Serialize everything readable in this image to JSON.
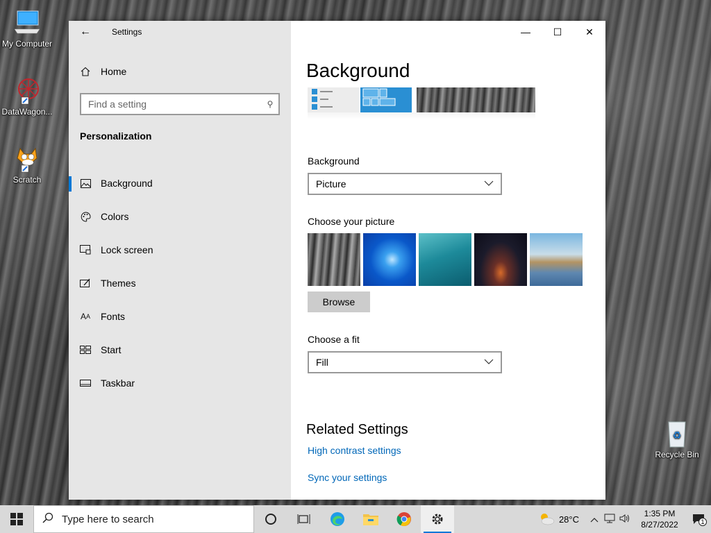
{
  "desktop": {
    "icons": [
      {
        "label": "My Computer"
      },
      {
        "label": "DataWagon..."
      },
      {
        "label": "Scratch"
      },
      {
        "label": "Recycle Bin"
      }
    ]
  },
  "window": {
    "title": "Settings",
    "nav": {
      "home": "Home",
      "search_placeholder": "Find a setting",
      "section": "Personalization",
      "items": [
        {
          "label": "Background",
          "icon": "picture-icon",
          "active": true
        },
        {
          "label": "Colors",
          "icon": "palette-icon"
        },
        {
          "label": "Lock screen",
          "icon": "lock-screen-icon"
        },
        {
          "label": "Themes",
          "icon": "themes-icon"
        },
        {
          "label": "Fonts",
          "icon": "fonts-icon"
        },
        {
          "label": "Start",
          "icon": "start-icon"
        },
        {
          "label": "Taskbar",
          "icon": "taskbar-icon"
        }
      ]
    },
    "content": {
      "title": "Background",
      "background_label": "Background",
      "background_value": "Picture",
      "choose_picture_label": "Choose your picture",
      "browse_label": "Browse",
      "fit_label": "Choose a fit",
      "fit_value": "Fill",
      "related_title": "Related Settings",
      "links": [
        "High contrast settings",
        "Sync your settings"
      ]
    }
  },
  "taskbar": {
    "search_placeholder": "Type here to search",
    "weather": "28°C",
    "time": "1:35 PM",
    "date": "8/27/2022",
    "notification_count": "1"
  },
  "colors": {
    "accent": "#0078d7",
    "link": "#0067b8"
  }
}
